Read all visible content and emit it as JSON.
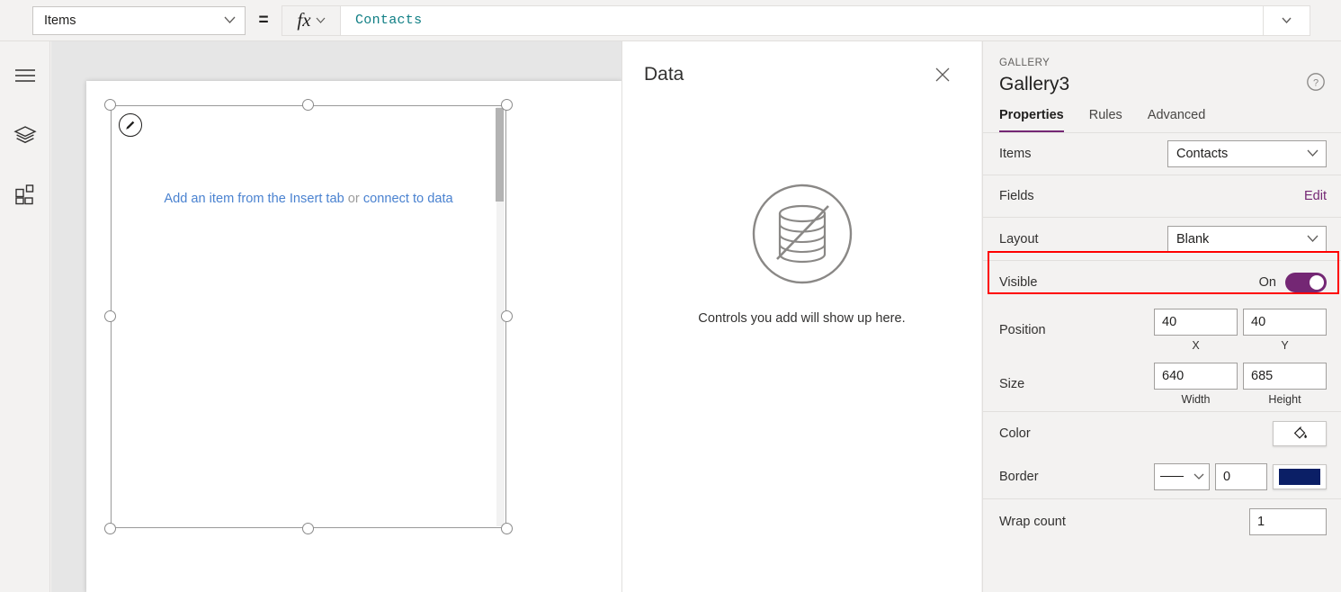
{
  "formula_bar": {
    "property_selected": "Items",
    "equals": "=",
    "fx_label": "fx",
    "formula_value": "Contacts"
  },
  "left_rail": {
    "items": [
      {
        "icon": "hamburger-menu-icon",
        "name": "menu"
      },
      {
        "icon": "layers-icon",
        "name": "tree-view"
      },
      {
        "icon": "grid-components-icon",
        "name": "insert"
      }
    ]
  },
  "canvas": {
    "gallery_hint_prefix": "Add an item from the Insert tab",
    "gallery_hint_middle": " or ",
    "gallery_hint_link": "connect to data",
    "edit_badge_icon": "pencil-icon"
  },
  "data_pane": {
    "title": "Data",
    "close_icon": "close-icon",
    "empty_icon": "database-slash-icon",
    "empty_caption": "Controls you add will show up here."
  },
  "properties": {
    "kind": "GALLERY",
    "name": "Gallery3",
    "help_icon": "help-circle-icon",
    "tabs": [
      {
        "label": "Properties",
        "active": true
      },
      {
        "label": "Rules",
        "active": false
      },
      {
        "label": "Advanced",
        "active": false
      }
    ],
    "items_label": "Items",
    "items_value": "Contacts",
    "fields_label": "Fields",
    "fields_action": "Edit",
    "layout_label": "Layout",
    "layout_value": "Blank",
    "visible_label": "Visible",
    "visible_state": "On",
    "position_label": "Position",
    "position_x": "40",
    "position_y": "40",
    "position_x_caption": "X",
    "position_y_caption": "Y",
    "size_label": "Size",
    "size_width": "640",
    "size_height": "685",
    "size_width_caption": "Width",
    "size_height_caption": "Height",
    "color_label": "Color",
    "color_icon": "paint-bucket-icon",
    "border_label": "Border",
    "border_style": "solid",
    "border_width": "0",
    "border_color": "#0b1f66",
    "wrap_count_label": "Wrap count",
    "wrap_count_value": "1"
  },
  "colors": {
    "accent_purple": "#742774",
    "formula_teal": "#0f7e84",
    "link_blue": "#4a82d0",
    "highlight_red": "#ff0000",
    "border_navy": "#0b1f66"
  }
}
